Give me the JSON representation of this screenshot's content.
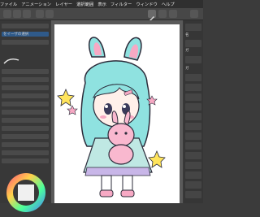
{
  "menubar": {
    "items": [
      "ファイル",
      "アニメーション",
      "レイヤー",
      "選択範囲",
      "表示",
      "フィルター",
      "ウィンドウ",
      "ヘルプ"
    ]
  },
  "left_panel": {
    "rows": [
      "",
      "をイーザの選択",
      "",
      "",
      "",
      "",
      "",
      "",
      "",
      "",
      "",
      "",
      "",
      "",
      "",
      "",
      ""
    ]
  },
  "right_panel": {
    "labels": [
      "名",
      "ガ",
      "ガ"
    ]
  }
}
